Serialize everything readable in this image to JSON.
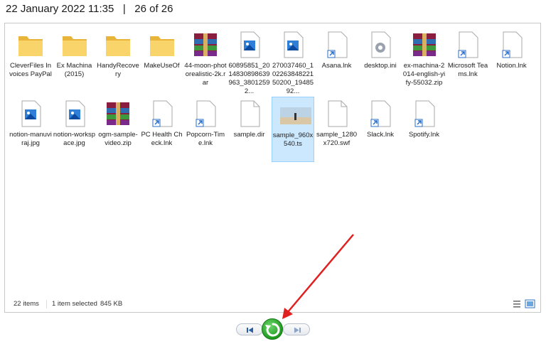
{
  "header": {
    "datetime": "22 January 2022 11:35",
    "separator": "|",
    "position": "26 of 26"
  },
  "files": [
    {
      "name": "CleverFiles Invoices PayPal",
      "type": "folder"
    },
    {
      "name": "Ex Machina (2015)",
      "type": "folder"
    },
    {
      "name": "HandyRecovery",
      "type": "folder"
    },
    {
      "name": "MakeUseOf",
      "type": "folder"
    },
    {
      "name": "44-moon-photorealistic-2k.rar",
      "type": "archive"
    },
    {
      "name": "60895851_2014830898639963_38012592...",
      "type": "image"
    },
    {
      "name": "270037460_10226384822150200_1948592...",
      "type": "image"
    },
    {
      "name": "Asana.lnk",
      "type": "shortcut"
    },
    {
      "name": "desktop.ini",
      "type": "settings"
    },
    {
      "name": "ex-machina-2014-english-yify-55032.zip",
      "type": "archive"
    },
    {
      "name": "Microsoft Teams.lnk",
      "type": "shortcut"
    },
    {
      "name": "Notion.lnk",
      "type": "shortcut"
    },
    {
      "name": "notion-manuviraj.jpg",
      "type": "image"
    },
    {
      "name": "notion-workspace.jpg",
      "type": "image"
    },
    {
      "name": "ogm-sample-video.zip",
      "type": "archive"
    },
    {
      "name": "PC Health Check.lnk",
      "type": "shortcut"
    },
    {
      "name": "Popcorn-Time.lnk",
      "type": "shortcut"
    },
    {
      "name": "sample.dir",
      "type": "file"
    },
    {
      "name": "sample_960x540.ts",
      "type": "video",
      "selected": true
    },
    {
      "name": "sample_1280x720.swf",
      "type": "file"
    },
    {
      "name": "Slack.lnk",
      "type": "shortcut"
    },
    {
      "name": "Spotify.lnk",
      "type": "shortcut"
    }
  ],
  "status": {
    "items": "22 items",
    "selected": "1 item selected",
    "size": "845 KB"
  },
  "colors": {
    "accent": "#cce8ff",
    "folder": "#f5c542",
    "play": "#2eaa2e",
    "annotation_arrow": "#e02020"
  },
  "icons": {
    "prev": "skip-back-icon",
    "play": "replay-icon",
    "next": "skip-forward-icon",
    "details_view": "details-view-icon",
    "large_icons_view": "large-icons-view-icon"
  }
}
